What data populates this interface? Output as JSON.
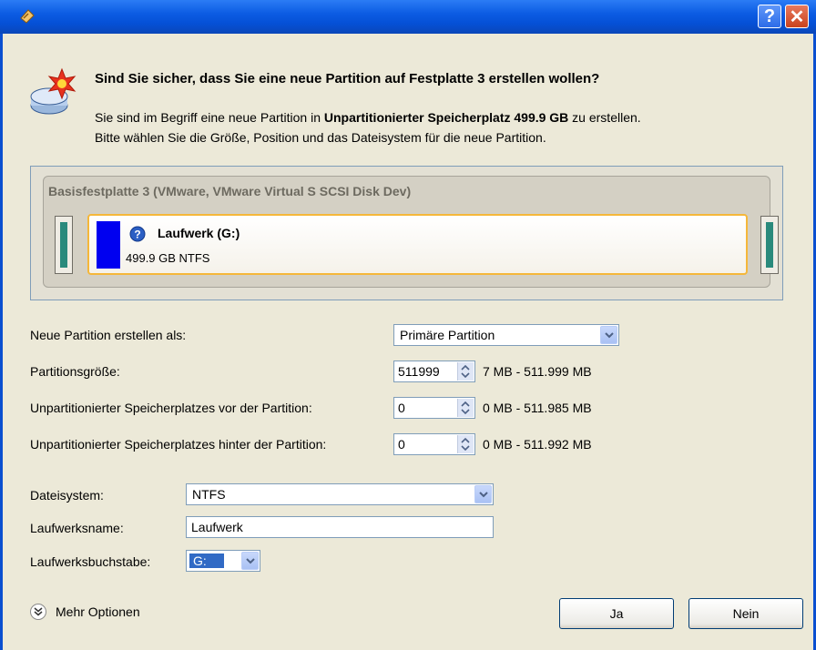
{
  "window": {
    "help_label": "?",
    "close_label": "✕"
  },
  "header": {
    "question": "Sind Sie sicher, dass Sie eine neue Partition auf Festplatte 3 erstellen wollen?",
    "info_prefix": "Sie sind im Begriff eine neue Partition in ",
    "info_bold": "Unpartitionierter Speicherplatz 499.9 GB",
    "info_suffix": " zu erstellen.",
    "info_line2": "Bitte wählen Sie die Größe, Position und das Dateisystem für die neue Partition."
  },
  "disk": {
    "title": "Basisfestplatte 3 (VMware, VMware Virtual S SCSI Disk Dev)",
    "volume_name": "Laufwerk (G:)",
    "volume_info": "499.9 GB NTFS",
    "volume_color": "#0000f0"
  },
  "form": {
    "create_as_label": "Neue Partition erstellen als:",
    "create_as_value": "Primäre Partition",
    "size_label": "Partitionsgröße:",
    "size_value": "511999",
    "size_range": "7 MB - 511.999 MB",
    "before_label": "Unpartitionierter Speicherplatzes vor der Partition:",
    "before_value": "0",
    "before_range": "0 MB - 511.985 MB",
    "after_label": "Unpartitionierter Speicherplatzes hinter der Partition:",
    "after_value": "0",
    "after_range": "0 MB - 511.992 MB",
    "fs_label": "Dateisystem:",
    "fs_value": "NTFS",
    "volname_label": "Laufwerksname:",
    "volname_value": "Laufwerk",
    "letter_label": "Laufwerksbuchstabe:",
    "letter_value": "G:"
  },
  "footer": {
    "more_options": "Mehr Optionen",
    "yes_label": "Ja",
    "no_label": "Nein"
  }
}
